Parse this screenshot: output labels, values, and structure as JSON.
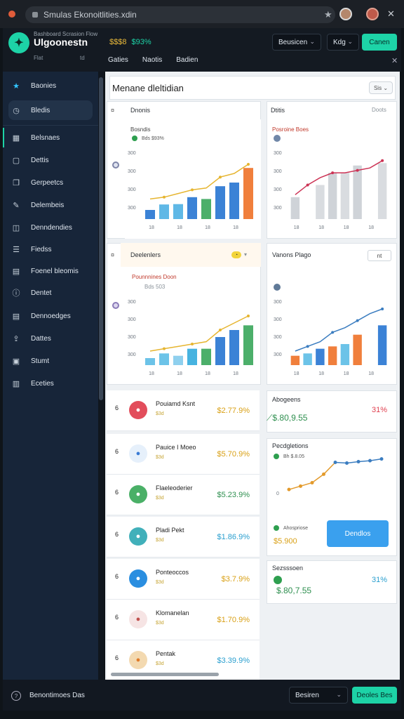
{
  "browser": {
    "url": "Smulas Ekonoitlities.xdin",
    "star_icon": "star-icon",
    "close_icon": "close-icon"
  },
  "header": {
    "title": "Ulgoonestn",
    "subtitle": "Bashboard Scrasion Flow",
    "tiny_left": "Flat",
    "tiny_right": "td",
    "value_main": "$$$8",
    "value_secondary": "$93%",
    "dropdown1": "Beusicen",
    "dropdown2": "Kdg",
    "primary_button": "Canen",
    "tabs": [
      "Gaties",
      "Naotis",
      "Badien"
    ],
    "active_tab": 0
  },
  "sidebar": {
    "items": [
      {
        "label": "Baonies",
        "icon": "star-icon"
      },
      {
        "label": "Bledis",
        "icon": "clock-icon"
      },
      {
        "label": "Belsnaes",
        "icon": "grid-icon"
      },
      {
        "label": "Dettis",
        "icon": "box-icon"
      },
      {
        "label": "Gerpeetcs",
        "icon": "pages-icon"
      },
      {
        "label": "Delembeis",
        "icon": "pen-icon"
      },
      {
        "label": "Denndendies",
        "icon": "layers-icon"
      },
      {
        "label": "Fiedss",
        "icon": "list-icon"
      },
      {
        "label": "Foenel bleomis",
        "icon": "table-icon"
      },
      {
        "label": "Dentet",
        "icon": "info-icon"
      },
      {
        "label": "Dennoedges",
        "icon": "table-icon"
      },
      {
        "label": "Dattes",
        "icon": "upload-icon"
      },
      {
        "label": "Stumt",
        "icon": "square-icon"
      },
      {
        "label": "Eceties",
        "icon": "chart-icon"
      }
    ],
    "selected_index": 1
  },
  "main": {
    "panel_title": "Menane dleltidian",
    "panel_button": "Sis",
    "card1": {
      "label": "Dnonis",
      "legend_top": "Bosndis",
      "legend_val": "Bds $93%"
    },
    "card2": {
      "label": "Dtitis",
      "label_right": "Doots",
      "legend_top": "Posroine Boes"
    },
    "card3": {
      "label": "Deelenlers",
      "legend_top": "Pounnnines Doon",
      "legend_val": "Bds 503"
    },
    "card4": {
      "label": "Vanons Plago",
      "badge": "nt"
    },
    "list_rows": [
      {
        "rank": "6",
        "name": "Pouiamd Ksnt",
        "sub": "$3d",
        "value": "$2.77.9%",
        "color": "#d9a016",
        "icon_bg": "#e24d5b",
        "icon_color": "#fff",
        "icon": "home-icon"
      },
      {
        "rank": "6",
        "name": "Pauice I Moeo",
        "sub": "$3d",
        "value": "$5.70.9%",
        "color": "#d9a016",
        "icon_bg": "#e6f0fb",
        "icon_color": "#3a7bd5",
        "icon": "doc-icon"
      },
      {
        "rank": "6",
        "name": "Flaeleoderier",
        "sub": "$3d",
        "value": "$5.23.9%",
        "color": "#2e8f4f",
        "icon_bg": "#4ab067",
        "icon_color": "#fff",
        "icon": "bag-icon"
      },
      {
        "rank": "6",
        "name": "Pladi Pekt",
        "sub": "$3d",
        "value": "$1.86.9%",
        "color": "#2a9fcf",
        "icon_bg": "#41b0ba",
        "icon_color": "#fff",
        "icon": "cloud-icon"
      },
      {
        "rank": "6",
        "name": "Ponteoccos",
        "sub": "$3d",
        "value": "$3.7.9%",
        "color": "#d9a016",
        "icon_bg": "#2a8ee0",
        "icon_color": "#fff",
        "icon": "clock-icon"
      },
      {
        "rank": "6",
        "name": "Klomanelan",
        "sub": "$3d",
        "value": "$1.70.9%",
        "color": "#d9a016",
        "icon_bg": "#f6e4e4",
        "icon_color": "#c0504d",
        "icon": "user-icon"
      },
      {
        "rank": "6",
        "name": "Pentak",
        "sub": "$3d",
        "value": "$3.39.9%",
        "color": "#2a9fcf",
        "icon_bg": "#f3d9b0",
        "icon_color": "#e07b2a",
        "icon": "case-icon"
      }
    ],
    "stat_card1": {
      "label": "Abogeens",
      "value": "$.80,9.55",
      "pct": "31%"
    },
    "stat_card2": {
      "label": "Pecdgletions",
      "legend": "Bh $.8.05",
      "bottom_label": "Ahospriose",
      "bottom_value": "$5.900",
      "button": "Dendlos"
    },
    "stat_card3": {
      "label": "Sezsssoen",
      "value": "$.80,7.55",
      "pct": "31%"
    }
  },
  "footer": {
    "label": "Benontimoes Das",
    "dropdown": "Besiren",
    "primary_button": "Deoles Bes"
  },
  "chart_data": [
    {
      "type": "bar",
      "title": "Dnonis",
      "categories": [
        "18",
        "18",
        "18",
        "18",
        "18",
        "18",
        "18",
        "18"
      ],
      "values": [
        50,
        80,
        82,
        120,
        110,
        180,
        200,
        280
      ],
      "line": [
        110,
        120,
        140,
        160,
        170,
        230,
        250,
        300
      ],
      "ylim": [
        0,
        400
      ],
      "yticks": [
        "300",
        "300",
        "300",
        "300"
      ]
    },
    {
      "type": "bar",
      "title": "Dtitis",
      "categories": [
        "18",
        "18",
        "18",
        "18",
        "18",
        "18",
        "18",
        "18"
      ],
      "values": [
        90,
        0,
        140,
        190,
        190,
        220,
        0,
        230
      ],
      "line": [
        100,
        140,
        170,
        190,
        190,
        200,
        210,
        240
      ],
      "ylim": [
        0,
        300
      ],
      "yticks": [
        "300",
        "300",
        "300",
        "300"
      ]
    },
    {
      "type": "bar",
      "title": "Deelenlers",
      "categories": [
        "18",
        "18",
        "18",
        "18",
        "18",
        "18",
        "18",
        "18"
      ],
      "values": [
        30,
        50,
        40,
        70,
        70,
        120,
        150,
        170
      ],
      "line": [
        60,
        70,
        80,
        90,
        100,
        150,
        180,
        210
      ],
      "ylim": [
        0,
        300
      ],
      "yticks": [
        "300",
        "300",
        "300",
        "300"
      ]
    },
    {
      "type": "bar",
      "title": "Vanons Plago",
      "categories": [
        "18",
        "18",
        "18",
        "18",
        "18",
        "18",
        "18",
        "18"
      ],
      "values": [
        40,
        50,
        70,
        80,
        90,
        130,
        0,
        170
      ],
      "line": [
        60,
        80,
        100,
        140,
        160,
        190,
        220,
        240
      ],
      "ylim": [
        0,
        300
      ],
      "yticks": [
        "300",
        "300",
        "300",
        "300"
      ]
    },
    {
      "type": "line",
      "title": "Pecdgletions",
      "x": [
        1,
        2,
        3,
        4,
        5,
        6,
        7,
        8,
        9
      ],
      "series": [
        {
          "values": [
            10,
            20,
            30,
            55,
            90,
            88,
            92,
            95,
            100
          ]
        }
      ],
      "ylim": [
        0,
        120
      ]
    }
  ]
}
